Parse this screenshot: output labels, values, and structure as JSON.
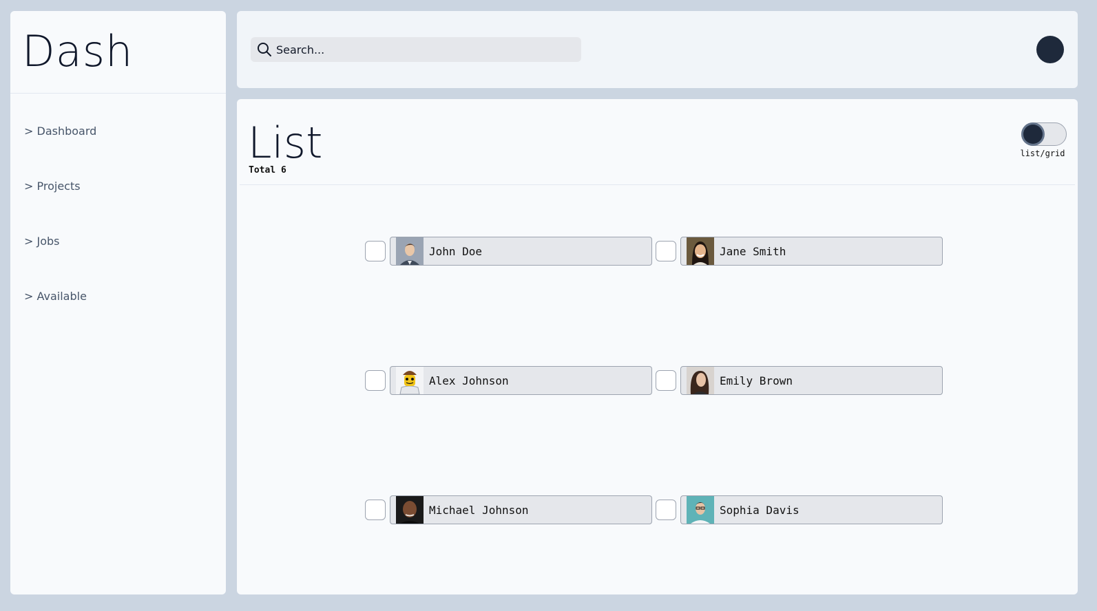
{
  "app": {
    "title": "Dash"
  },
  "sidebar": {
    "items": [
      {
        "label": "> Dashboard"
      },
      {
        "label": "> Projects"
      },
      {
        "label": "> Jobs"
      },
      {
        "label": "> Available"
      }
    ]
  },
  "topbar": {
    "search": {
      "placeholder": "Search..."
    }
  },
  "main": {
    "title": "List",
    "total": "Total 6",
    "toggle": {
      "label": "list/grid",
      "state": "list"
    },
    "people": [
      {
        "name": "John Doe",
        "avatar": "man-portrait-grey"
      },
      {
        "name": "Jane Smith",
        "avatar": "woman-portrait-dark-hair"
      },
      {
        "name": "Alex Johnson",
        "avatar": "lego-figure"
      },
      {
        "name": "Emily Brown",
        "avatar": "woman-portrait-brown-hair"
      },
      {
        "name": "Michael Johnson",
        "avatar": "man-portrait-bald"
      },
      {
        "name": "Sophia Davis",
        "avatar": "person-portrait-teal-bg"
      }
    ]
  },
  "colors": {
    "background": "#cbd5e1",
    "panel": "#f8fafc",
    "accent": "#1e293b"
  }
}
